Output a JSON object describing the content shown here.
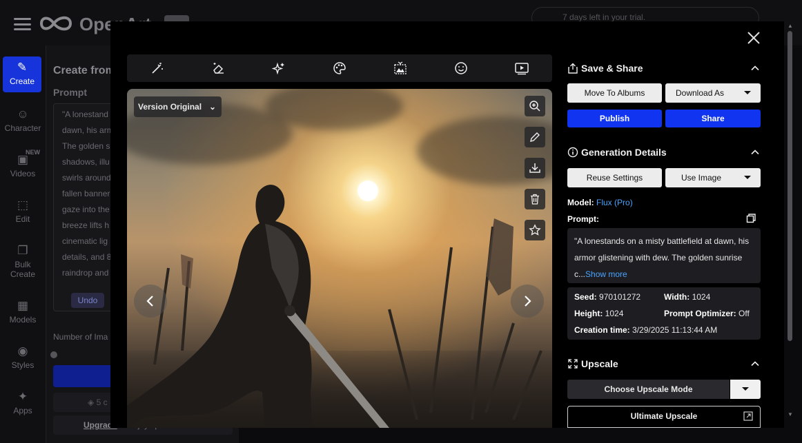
{
  "app": {
    "logo_text": "OpenArt",
    "trial_text": "7 days left in your trial."
  },
  "sidebar": {
    "items": [
      {
        "label": "Create",
        "icon": "create-icon"
      },
      {
        "label": "Character",
        "icon": "character-icon",
        "badge": "NEW"
      },
      {
        "label": "Videos",
        "icon": "videos-icon"
      },
      {
        "label": "Edit",
        "icon": "edit-icon"
      },
      {
        "label": "Bulk Create",
        "icon": "bulk-create-icon"
      },
      {
        "label": "Models",
        "icon": "models-icon"
      },
      {
        "label": "Styles",
        "icon": "styles-icon"
      },
      {
        "label": "Apps",
        "icon": "apps-icon"
      }
    ]
  },
  "left_panel": {
    "title": "Create from",
    "prompt_label": "Prompt",
    "prompt_lines": [
      "\"A lonestand",
      "dawn, his arm",
      "The golden s",
      "shadows, illu",
      "swirls around",
      "fallen banner",
      "gaze into the",
      "breeze lifts h",
      "cinematic lig",
      "details, and 8",
      "raindrop and"
    ],
    "undo_label": "Undo",
    "num_images_label": "Number of Ima",
    "cost_text": "5 c",
    "upgrade_link": "Upgrade",
    "upgrade_text": " to enjoy speed boost"
  },
  "modal": {
    "toolbar_icons": [
      "magic-wand-icon",
      "eraser-icon",
      "sparkles-icon",
      "palette-icon",
      "image-expand-icon",
      "face-icon",
      "video-play-icon"
    ],
    "version_label": "Version Original",
    "save_share": {
      "title": "Save & Share",
      "move_to_albums": "Move To Albums",
      "download_as": "Download As",
      "publish": "Publish",
      "share": "Share"
    },
    "generation": {
      "title": "Generation Details",
      "reuse_settings": "Reuse Settings",
      "use_image": "Use Image",
      "model_label": "Model:",
      "model_value": "Flux (Pro)",
      "prompt_label": "Prompt:",
      "prompt_text": "\"A lonestands on a misty battlefield at dawn, his armor glistening with dew. The golden sunrise c...",
      "show_more": "Show more",
      "seed_label": "Seed:",
      "seed_value": "970101272",
      "width_label": "Width:",
      "width_value": "1024",
      "height_label": "Height:",
      "height_value": "1024",
      "optimizer_label": "Prompt Optimizer:",
      "optimizer_value": "Off",
      "creation_label": "Creation time:",
      "creation_value": "3/29/2025 11:13:44 AM"
    },
    "upscale": {
      "title": "Upscale",
      "choose_mode": "Choose Upscale Mode",
      "ultimate": "Ultimate Upscale"
    }
  },
  "colors": {
    "accent_blue": "#1034f0",
    "link_blue": "#4aa3ff",
    "create_active": "#1634d9"
  }
}
